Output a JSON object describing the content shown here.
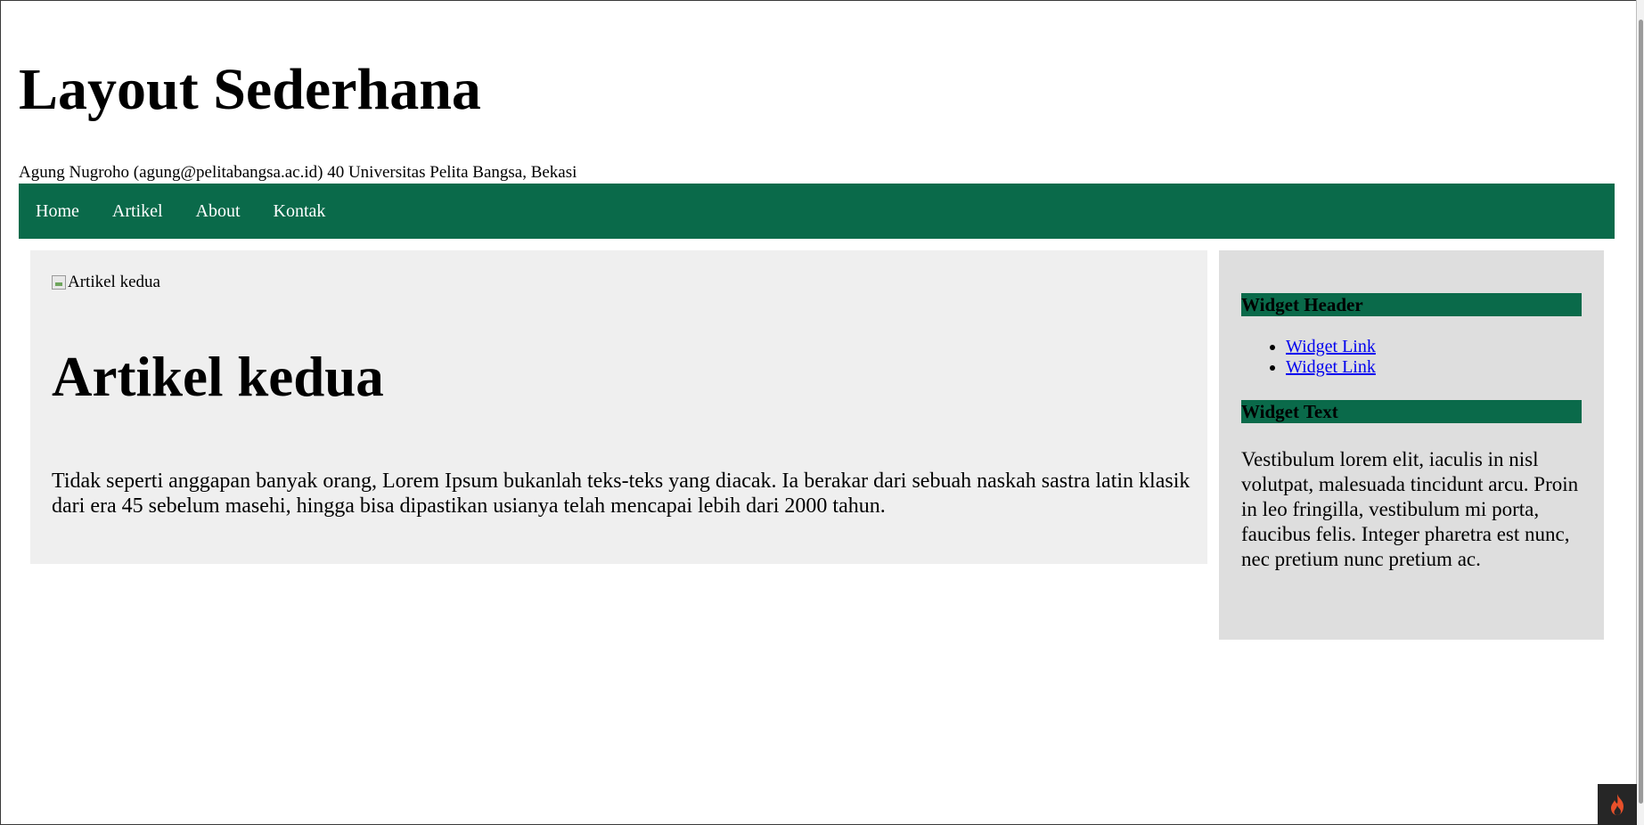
{
  "header": {
    "title": "Layout Sederhana",
    "subtitle": "Agung Nugroho (agung@pelitabangsa.ac.id) 40 Universitas Pelita Bangsa, Bekasi"
  },
  "nav": {
    "items": [
      {
        "label": "Home"
      },
      {
        "label": "Artikel"
      },
      {
        "label": "About"
      },
      {
        "label": "Kontak"
      }
    ]
  },
  "article": {
    "image_alt": "Artikel kedua",
    "title": "Artikel kedua",
    "body": "Tidak seperti anggapan banyak orang, Lorem Ipsum bukanlah teks-teks yang diacak. Ia berakar dari sebuah naskah sastra latin klasik dari era 45 sebelum masehi, hingga bisa dipastikan usianya telah mencapai lebih dari 2000 tahun."
  },
  "sidebar": {
    "widget_header": "Widget Header",
    "links": [
      {
        "label": "Widget Link"
      },
      {
        "label": "Widget Link"
      }
    ],
    "widget_text_header": "Widget Text",
    "widget_text": "Vestibulum lorem elit, iaculis in nisl volutpat, malesuada tincidunt arcu. Proin in leo fringilla, vestibulum mi porta, faucibus felis. Integer pharetra est nunc, nec pretium nunc pretium ac."
  },
  "colors": {
    "accent": "#0a6a4a",
    "main_bg": "#efefef",
    "sidebar_bg": "#dedede"
  },
  "icons": {
    "broken_image": "broken-image-icon",
    "devtool": "flame-icon"
  }
}
